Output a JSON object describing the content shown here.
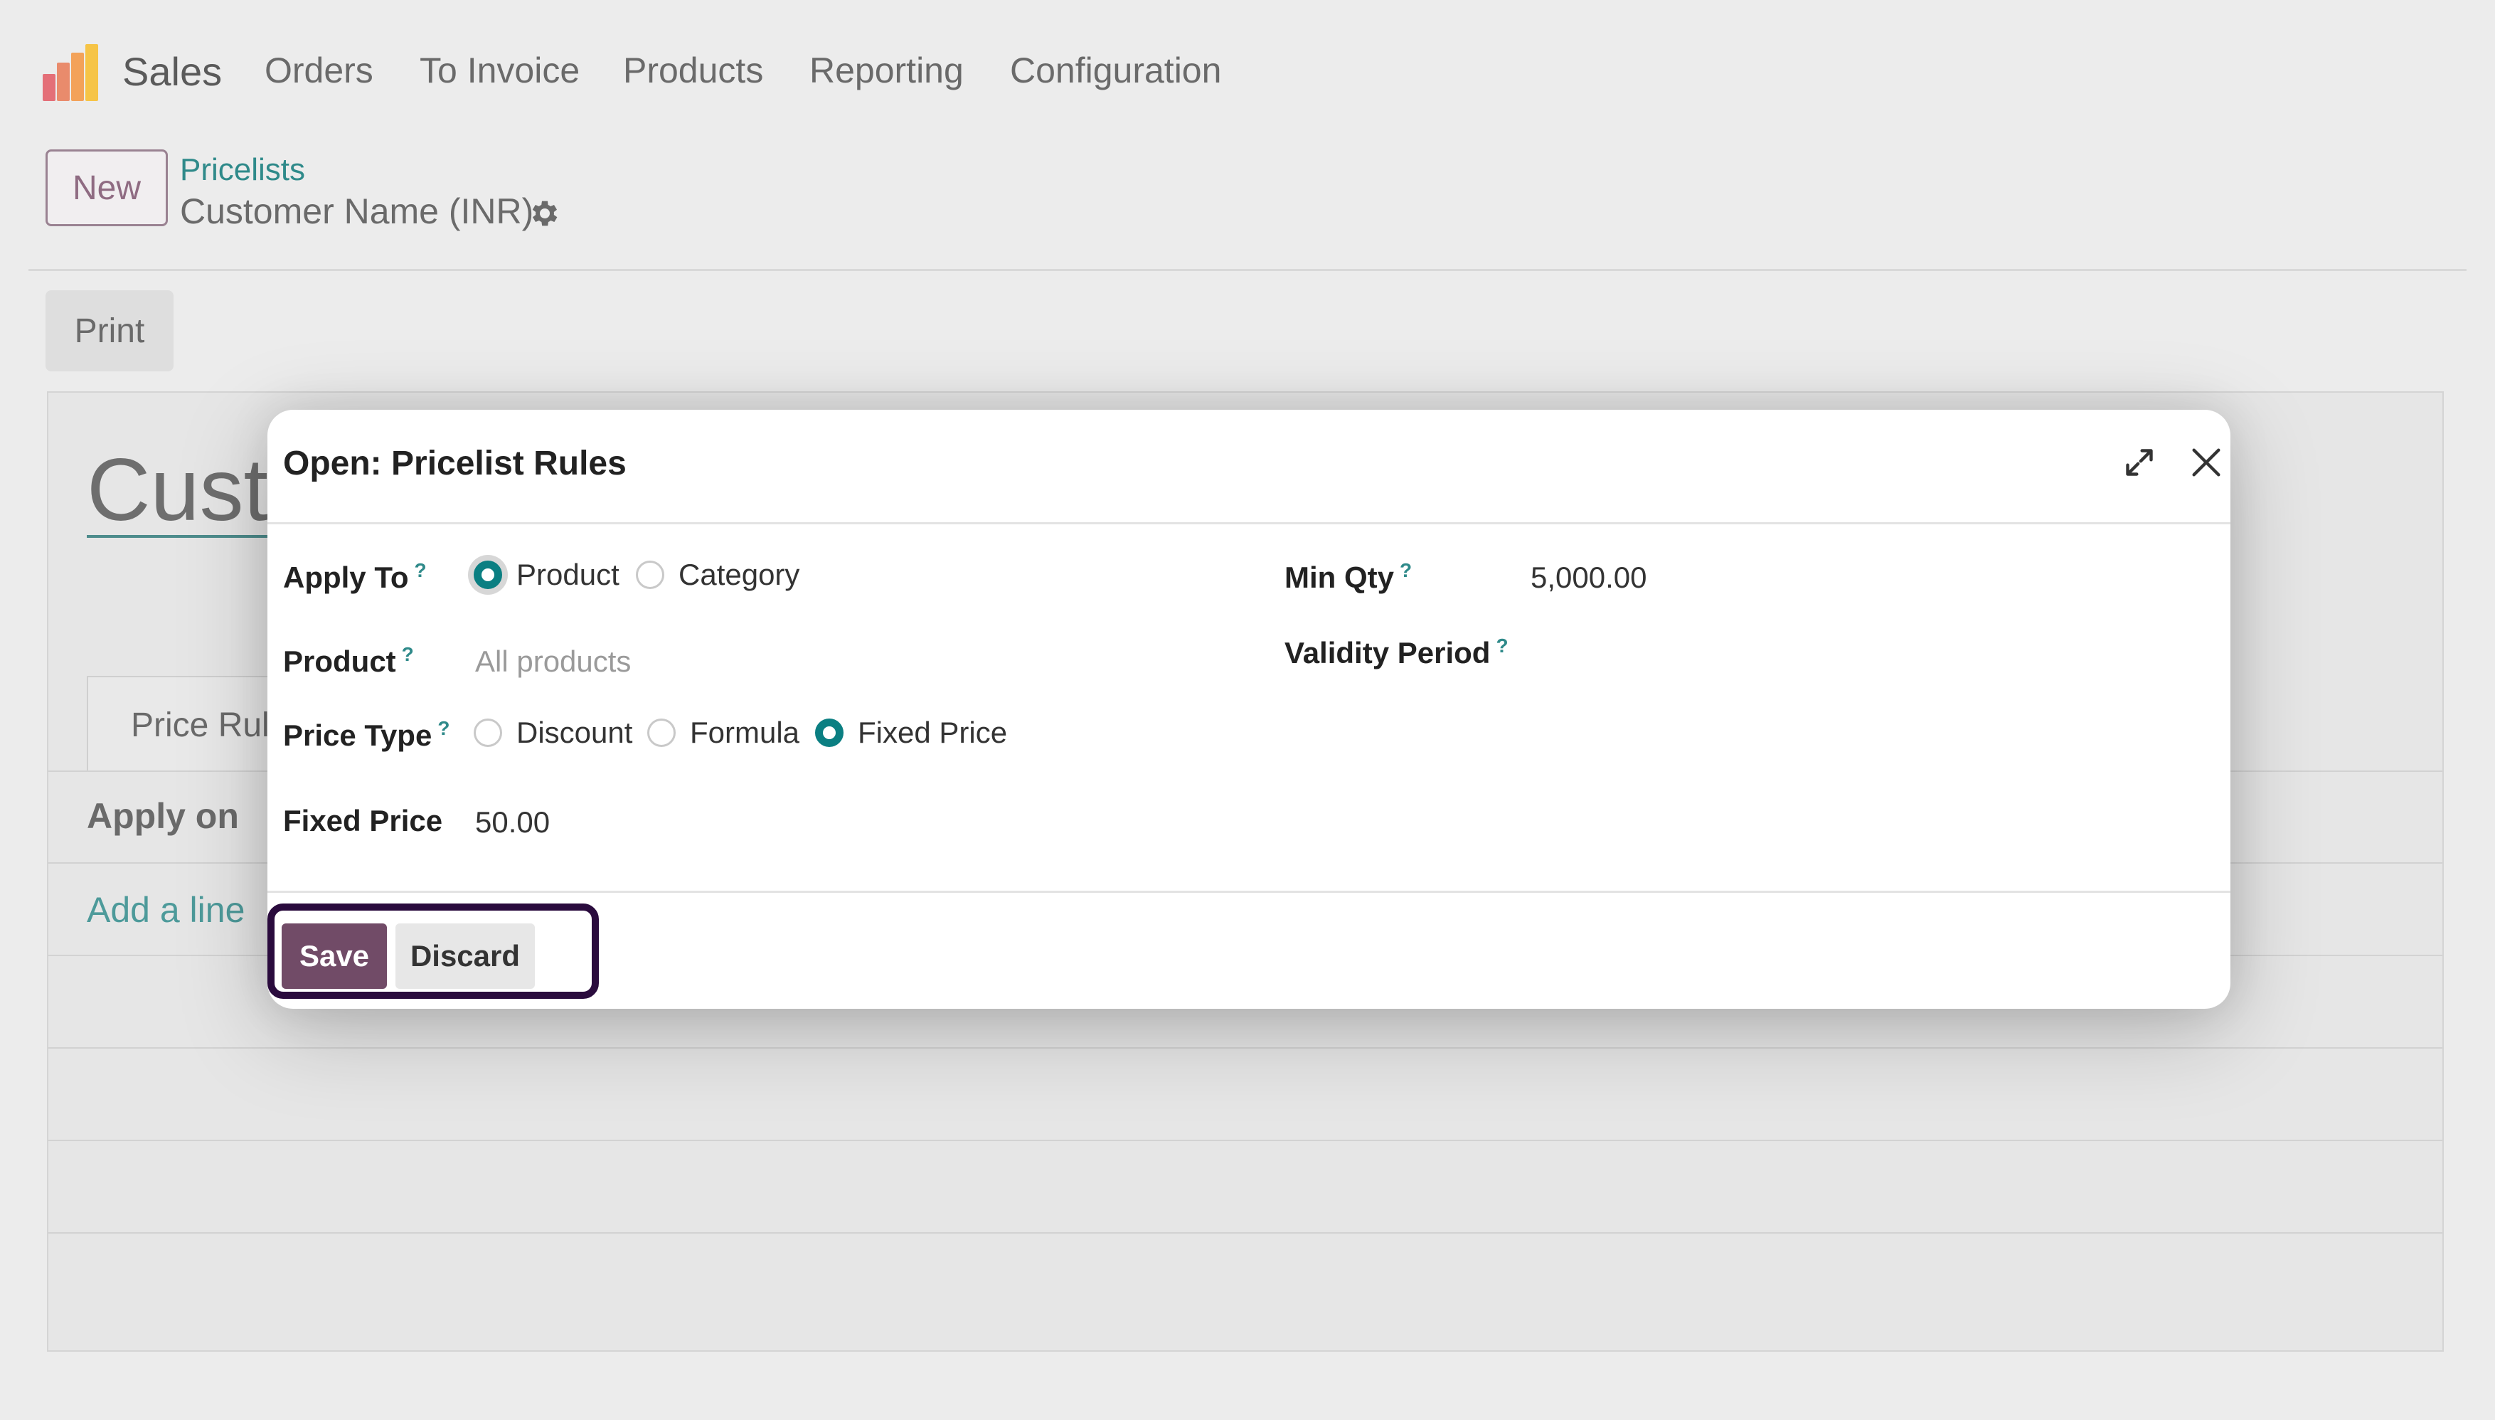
{
  "topnav": {
    "app_name": "Sales",
    "menu": [
      "Orders",
      "To Invoice",
      "Products",
      "Reporting",
      "Configuration"
    ],
    "logo_colors": [
      "#e46f78",
      "#f3a259",
      "#f6c446",
      "#8a5aa0"
    ]
  },
  "control_panel": {
    "new_label": "New",
    "breadcrumb_parent": "Pricelists",
    "breadcrumb_current": "Customer Name (INR)",
    "print_label": "Print"
  },
  "sheet": {
    "title_partial": "Custo",
    "tab_label": "Price Rule",
    "column_apply_on": "Apply on",
    "add_line_label": "Add a line"
  },
  "modal": {
    "title": "Open: Pricelist Rules",
    "fields": {
      "apply_to": {
        "label": "Apply To",
        "help": "?",
        "options": [
          "Product",
          "Category"
        ],
        "selected": "Product"
      },
      "product": {
        "label": "Product",
        "help": "?",
        "placeholder": "All products"
      },
      "price_type": {
        "label": "Price Type",
        "help": "?",
        "options": [
          "Discount",
          "Formula",
          "Fixed Price"
        ],
        "selected": "Fixed Price"
      },
      "fixed_price": {
        "label": "Fixed Price",
        "value": "50.00"
      },
      "min_qty": {
        "label": "Min Qty",
        "help": "?",
        "value": "5,000.00"
      },
      "validity_period": {
        "label": "Validity Period",
        "help": "?"
      }
    },
    "footer": {
      "save_label": "Save",
      "discard_label": "Discard"
    }
  },
  "colors": {
    "accent_teal": "#0b7f82",
    "primary_button": "#714b67",
    "highlight_border": "#2a0b3d"
  }
}
